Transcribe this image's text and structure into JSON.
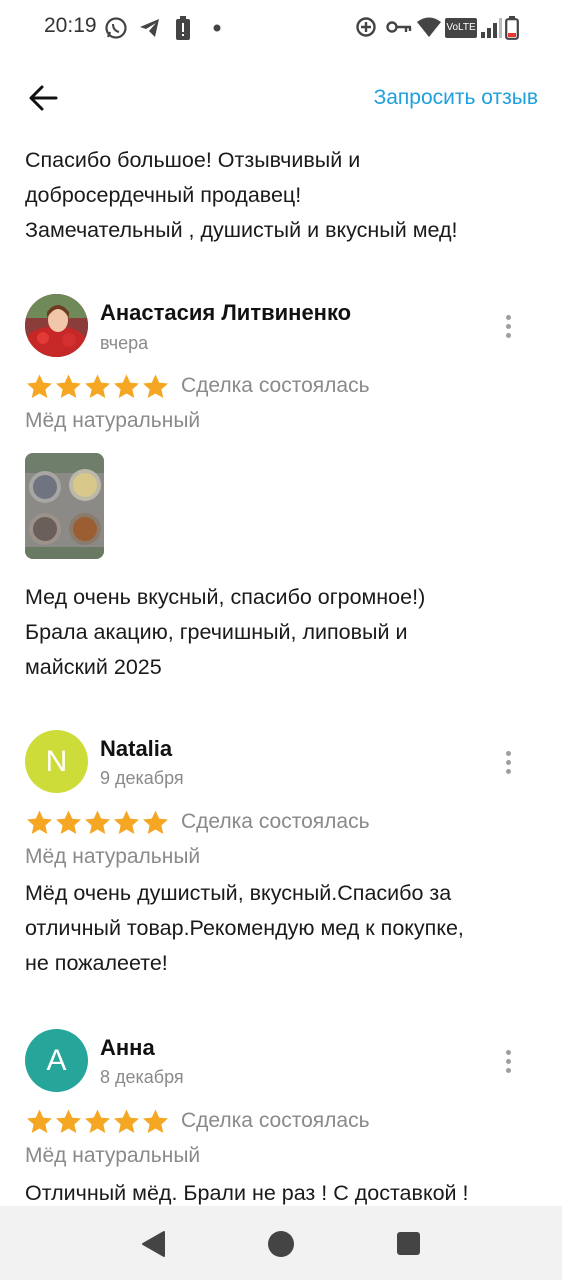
{
  "status_bar": {
    "time": "20:19",
    "icons_left": [
      "whatsapp-icon",
      "telegram-icon",
      "battery-saver-icon",
      "dot-icon"
    ],
    "icons_right": [
      "data-saver-icon",
      "key-icon",
      "wifi-icon",
      "volte-icon",
      "signal-icon",
      "battery-icon"
    ],
    "volte_label": "VoLTE"
  },
  "top_bar": {
    "back_icon": "arrow-left-icon",
    "request_link": "Запросить отзыв",
    "accent_color": "#1ea0de"
  },
  "prev_review_text": [
    "Спасибо большое! Отзывчивый и",
    "добросердечный продавец!",
    "Замечательный , душистый и вкусный мед!"
  ],
  "reviews": [
    {
      "name": "Анастасия Литвиненко",
      "date": "вчера",
      "rating": 5,
      "deal": "Сделка состоялась",
      "product": "Мёд натуральный",
      "text": [
        "Мед очень вкусный, спасибо огромное!)",
        "Брала акацию, гречишный, липовый и",
        "майский 2025"
      ]
    },
    {
      "name": "Natalia",
      "date": "9 декабря",
      "avatar_letter": "N",
      "avatar_color": "#cddc39",
      "rating": 5,
      "deal": "Сделка состоялась",
      "product": "Мёд натуральный",
      "text": [
        "Мёд очень душистый, вкусный.Спасибо за",
        "отличный товар.Рекомендую мед к покупке,",
        "не пожалеете!"
      ]
    },
    {
      "name": "Анна",
      "date": "8 декабря",
      "avatar_letter": "A",
      "avatar_color": "#26a69a",
      "rating": 5,
      "deal": "Сделка состоялась",
      "product": "Мёд натуральный",
      "text": [
        "Отличный мёд. Брали не раз ! С доставкой !"
      ]
    }
  ],
  "star_color": "#f5a623",
  "nav_bar": {
    "icons": [
      "back-triangle-icon",
      "home-circle-icon",
      "recents-square-icon"
    ]
  }
}
